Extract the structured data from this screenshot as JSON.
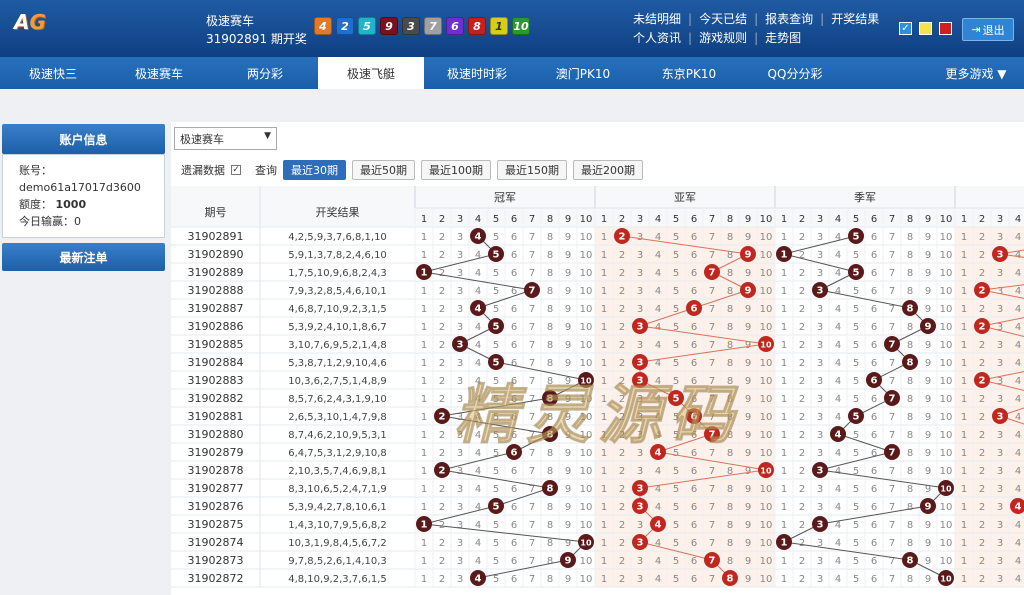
{
  "header": {
    "logo": "AG",
    "game_name": "极速赛车",
    "period": "31902891 期开奖",
    "latest_balls": [
      {
        "n": "4",
        "color": "#e07a2a"
      },
      {
        "n": "2",
        "color": "#1f6fd1"
      },
      {
        "n": "5",
        "color": "#1fb4c9"
      },
      {
        "n": "9",
        "color": "#7a1020"
      },
      {
        "n": "3",
        "color": "#4a4a4a"
      },
      {
        "n": "7",
        "color": "#a0a0a0"
      },
      {
        "n": "6",
        "color": "#6d2fd0"
      },
      {
        "n": "8",
        "color": "#c81e1e"
      },
      {
        "n": "1",
        "color": "#d6cc1a"
      },
      {
        "n": "10",
        "color": "#2a9b2a"
      }
    ],
    "links_row1": [
      "未结明细",
      "今天已结",
      "报表查询",
      "开奖结果"
    ],
    "links_row2": [
      "个人资讯",
      "游戏规则",
      "走势图"
    ],
    "logout": "退出",
    "theme_colors": [
      "#2c8fe0",
      "#f4e34a",
      "#d01f1f"
    ]
  },
  "nav": {
    "items": [
      "极速快三",
      "极速赛车",
      "两分彩",
      "极速飞艇",
      "极速时时彩",
      "澳门PK10",
      "东京PK10",
      "QQ分分彩"
    ],
    "active_index": 3,
    "more": "更多游戏 ▼"
  },
  "sidebar": {
    "title": "账户信息",
    "account_label": "账号：",
    "account": "demo61a17017d3600",
    "credit_label": "额度：",
    "credit": "1000",
    "pnl_label": "今日输赢：",
    "pnl": "0",
    "recent_bets": "最新注单"
  },
  "filters": {
    "select_value": "极速赛车",
    "omit_label": "遗漏数据",
    "query_label": "查询",
    "buttons": [
      "最近30期",
      "最近50期",
      "最近100期",
      "最近150期",
      "最近200期"
    ],
    "active": 0
  },
  "table": {
    "col_period": "期号",
    "col_result": "开奖结果",
    "groups": [
      "冠军",
      "亚军",
      "季军"
    ],
    "rows": [
      {
        "period": "31902891",
        "result": "4,2,5,9,3,7,6,8,1,10"
      },
      {
        "period": "31902890",
        "result": "5,9,1,3,7,8,2,4,6,10"
      },
      {
        "period": "31902889",
        "result": "1,7,5,10,9,6,8,2,4,3"
      },
      {
        "period": "31902888",
        "result": "7,9,3,2,8,5,4,6,10,1"
      },
      {
        "period": "31902887",
        "result": "4,6,8,7,10,9,2,3,1,5"
      },
      {
        "period": "31902886",
        "result": "5,3,9,2,4,10,1,8,6,7"
      },
      {
        "period": "31902885",
        "result": "3,10,7,6,9,5,2,1,4,8"
      },
      {
        "period": "31902884",
        "result": "5,3,8,7,1,2,9,10,4,6"
      },
      {
        "period": "31902883",
        "result": "10,3,6,2,7,5,1,4,8,9"
      },
      {
        "period": "31902882",
        "result": "8,5,7,6,2,4,3,1,9,10"
      },
      {
        "period": "31902881",
        "result": "2,6,5,3,10,1,4,7,9,8"
      },
      {
        "period": "31902880",
        "result": "8,7,4,6,2,10,9,5,3,1"
      },
      {
        "period": "31902879",
        "result": "6,4,7,5,3,1,2,9,10,8"
      },
      {
        "period": "31902878",
        "result": "2,10,3,5,7,4,6,9,8,1"
      },
      {
        "period": "31902877",
        "result": "8,3,10,6,5,2,4,7,1,9"
      },
      {
        "period": "31902876",
        "result": "5,3,9,4,2,7,8,10,6,1"
      },
      {
        "period": "31902875",
        "result": "1,4,3,10,7,9,5,6,8,2"
      },
      {
        "period": "31902874",
        "result": "10,3,1,9,8,4,5,6,7,2"
      },
      {
        "period": "31902873",
        "result": "9,7,8,5,2,6,1,4,10,3"
      },
      {
        "period": "31902872",
        "result": "4,8,10,9,2,3,7,6,1,5"
      }
    ]
  },
  "watermark": "精灵源码",
  "colors": {
    "hit_dark": "#5a1a1a",
    "hit_red": "#c0281f",
    "grid_line": "#dde4ec"
  }
}
